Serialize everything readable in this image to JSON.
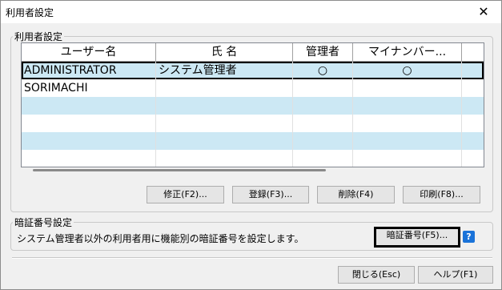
{
  "window": {
    "title": "利用者設定",
    "close_glyph": "✕"
  },
  "users_group": {
    "label": "利用者設定"
  },
  "table": {
    "columns": [
      "ユーザー名",
      "氏 名",
      "管理者",
      "マイナンバー..."
    ],
    "rows": [
      {
        "user": "ADMINISTRATOR",
        "name": "システム管理者",
        "admin": "○",
        "mynumber": "○"
      },
      {
        "user": "SORIMACHI",
        "name": "",
        "admin": "",
        "mynumber": ""
      },
      {
        "user": "",
        "name": "",
        "admin": "",
        "mynumber": ""
      },
      {
        "user": "",
        "name": "",
        "admin": "",
        "mynumber": ""
      },
      {
        "user": "",
        "name": "",
        "admin": "",
        "mynumber": ""
      },
      {
        "user": "",
        "name": "",
        "admin": "",
        "mynumber": ""
      }
    ]
  },
  "buttons": {
    "modify": "修正(F2)...",
    "register": "登録(F3)...",
    "delete": "削除(F4)",
    "print": "印刷(F8)...",
    "pin": "暗証番号(F5)...",
    "close": "閉じる(Esc)",
    "help": "ヘルプ(F1)"
  },
  "pin_group": {
    "label": "暗証番号設定",
    "description": "システム管理者以外の利用者用に機能別の暗証番号を設定します。"
  },
  "icons": {
    "help": "?"
  },
  "colors": {
    "alt_row": "#cce8f4",
    "help_icon": "#1a73d9"
  }
}
